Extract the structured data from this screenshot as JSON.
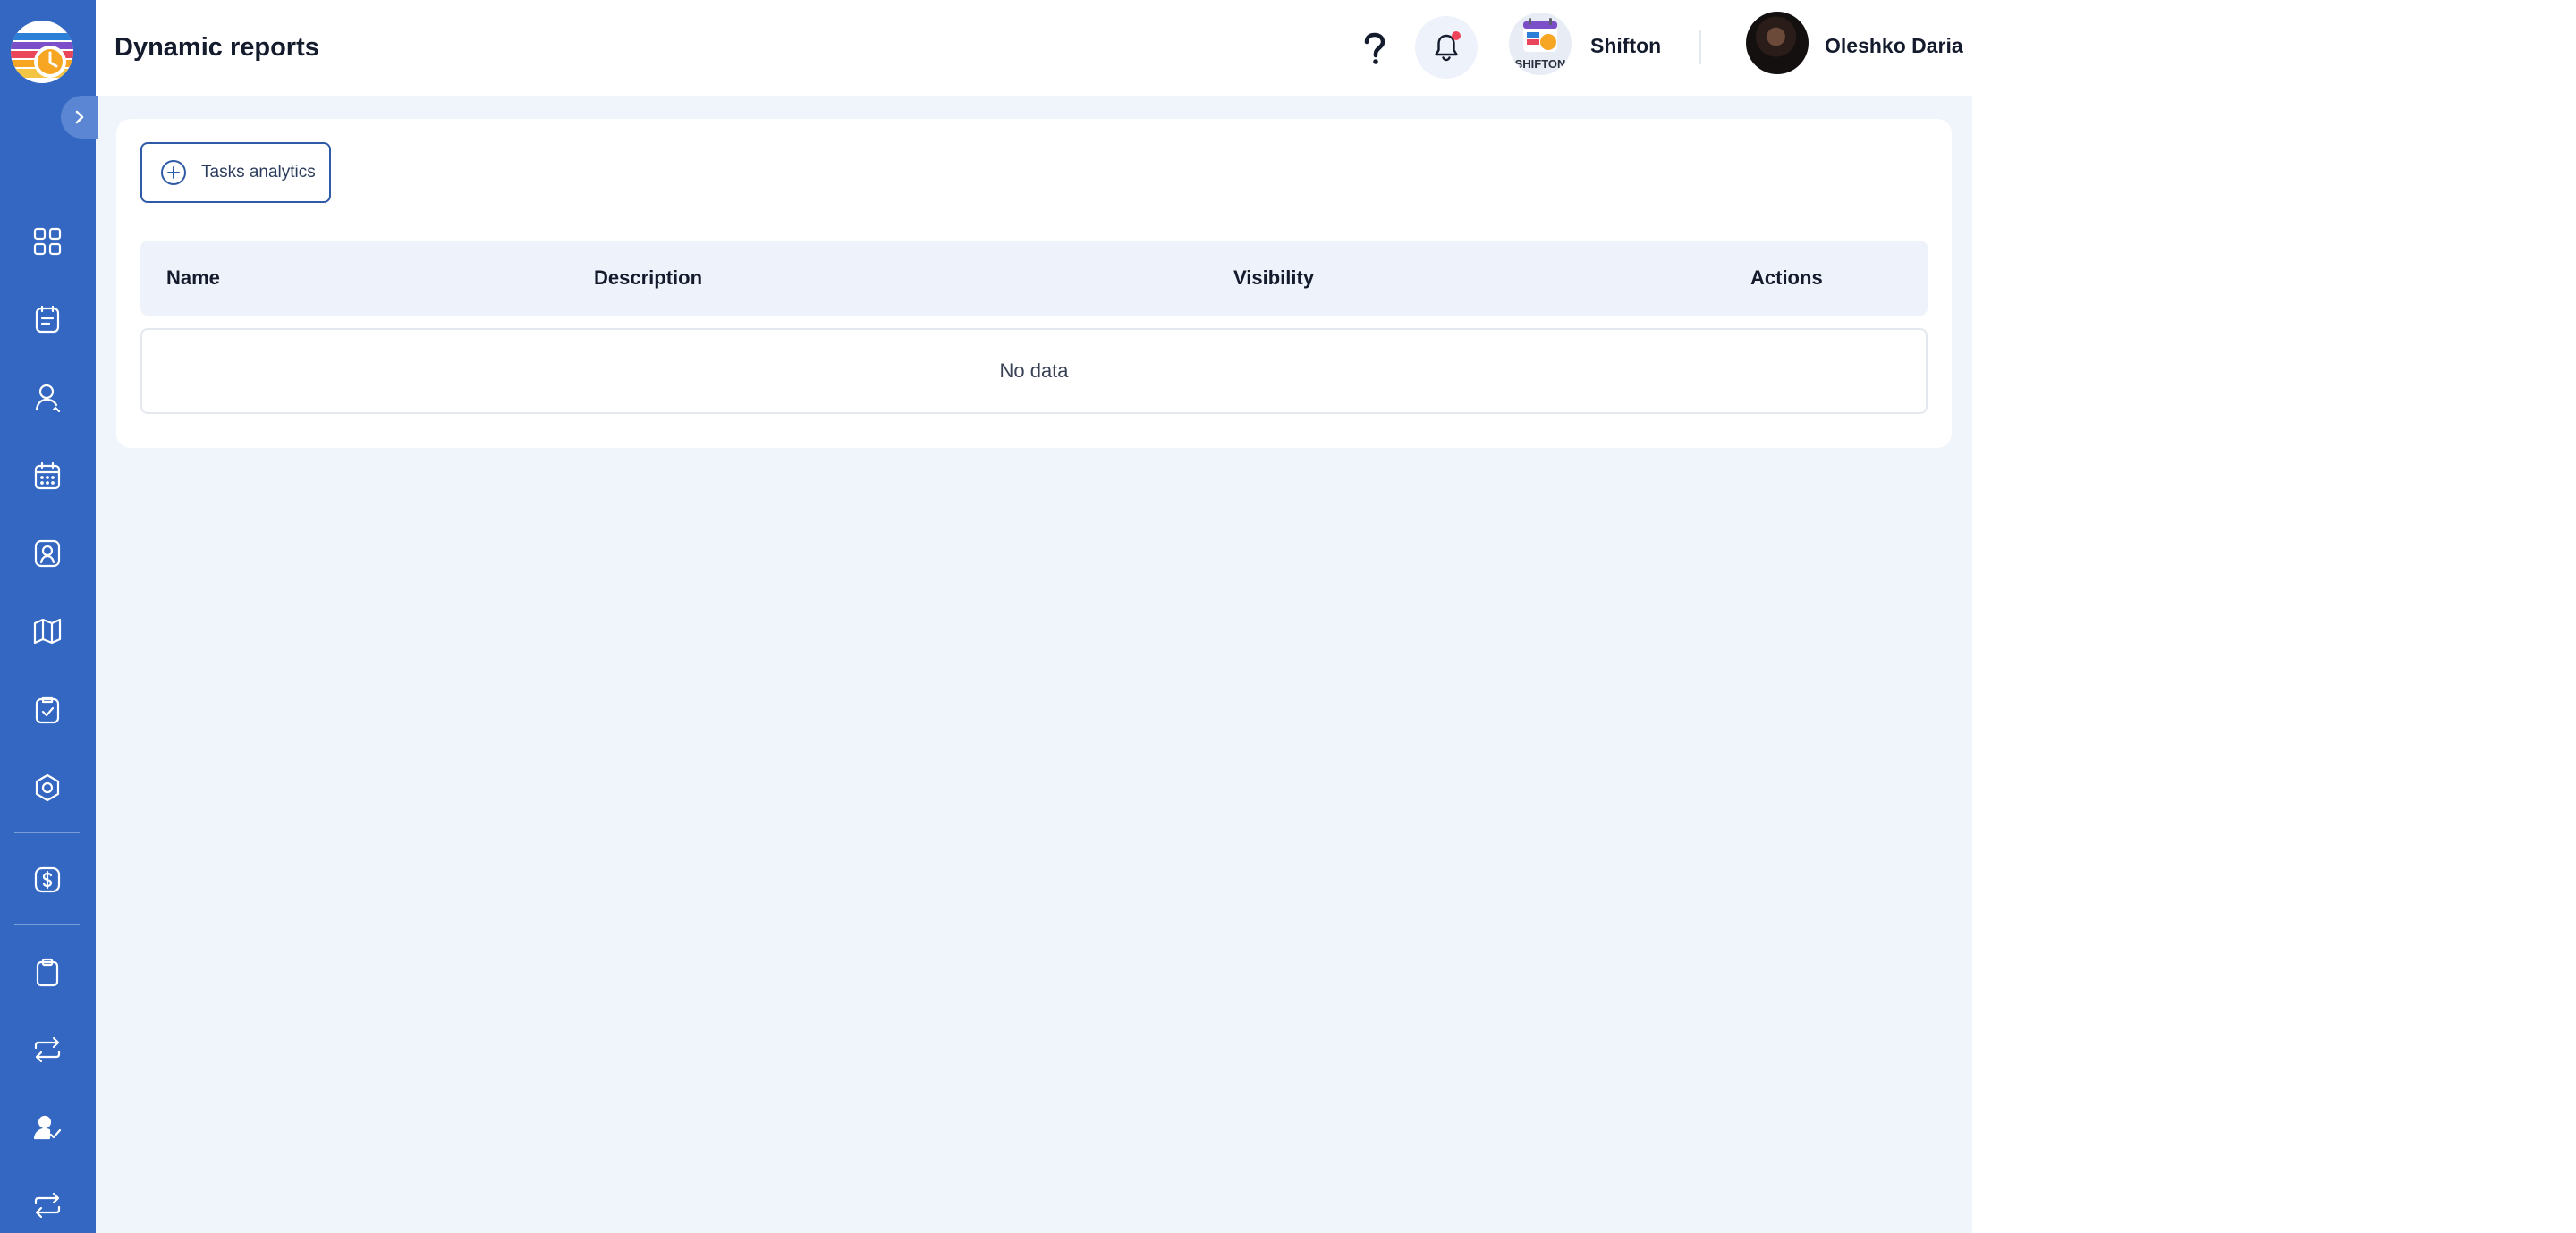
{
  "header": {
    "title": "Dynamic reports",
    "company_name": "Shifton",
    "user_name": "Oleshko Daria",
    "help_icon": "question-mark-icon",
    "notifications_icon": "bell-icon",
    "notification_dot_color": "#f0445a"
  },
  "sidebar": {
    "background_color": "#3367c2",
    "items": [
      {
        "icon": "dashboard-grid-icon"
      },
      {
        "icon": "tasks-icon"
      },
      {
        "icon": "employees-icon"
      },
      {
        "icon": "calendar-icon"
      },
      {
        "icon": "badge-icon"
      },
      {
        "icon": "map-icon"
      },
      {
        "icon": "clipboard-check-icon"
      },
      {
        "icon": "hexagon-settings-icon"
      },
      {
        "icon": "dollar-icon"
      },
      {
        "icon": "clipboard-icon"
      },
      {
        "icon": "repeat-icon"
      },
      {
        "icon": "user-check-icon"
      },
      {
        "icon": "repeat-alt-icon"
      }
    ]
  },
  "toolbar": {
    "add_report_label": "Tasks analytics",
    "add_report_icon": "plus-circle-icon"
  },
  "table": {
    "columns": [
      "Name",
      "Description",
      "Visibility",
      "Actions"
    ],
    "rows": [],
    "empty_text": "No data"
  }
}
